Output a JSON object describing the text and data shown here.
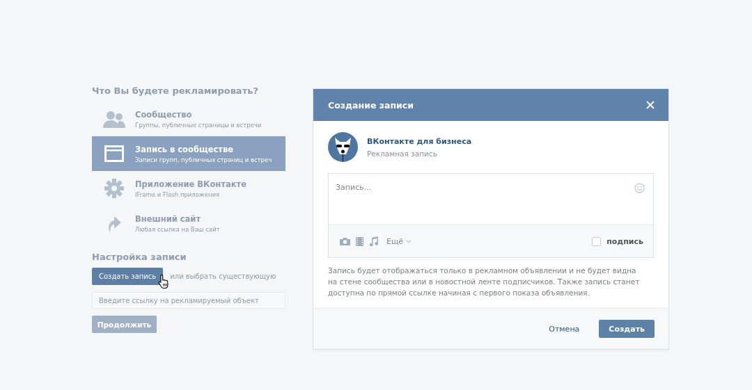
{
  "ad_setup": {
    "title": "Что Вы будете рекламировать?",
    "options": [
      {
        "title": "Сообщество",
        "subtitle": "Группы, публичные страницы и встречи",
        "selected": false
      },
      {
        "title": "Запись в сообществе",
        "subtitle": "Записи групп, публичных страниц и встреч",
        "selected": true
      },
      {
        "title": "Приложение ВКонтакте",
        "subtitle": "IFrame и Flash приложения",
        "selected": false
      },
      {
        "title": "Внешний сайт",
        "subtitle": "Любая ссылка на Ваш сайт",
        "selected": false
      }
    ],
    "post_settings_title": "Настройка записи",
    "create_button": "Создать запись",
    "or_text": "или выбрать существующую",
    "link_field": {
      "placeholder": "Введите ссылку на рекламируемый объект"
    },
    "continue_button": {
      "label": "Продолжить",
      "disabled": true
    }
  },
  "dialog": {
    "title": "Создание записи",
    "author": {
      "name": "ВКонтакте для бизнеса",
      "subtitle": "Рекламная запись"
    },
    "post_field": {
      "placeholder": "Запись..."
    },
    "more_menu": "Ещё",
    "signature": {
      "label": "подпись",
      "checked": false
    },
    "note": "Запись будет отображаться только в рекламном объявлении и не будет видна на стене сообщества или в новостной ленте подписчиков. Также запись станет доступна по прямой ссылке начиная с первого показа объявления.",
    "cancel_button": "Отмена",
    "create_button": "Создать"
  }
}
